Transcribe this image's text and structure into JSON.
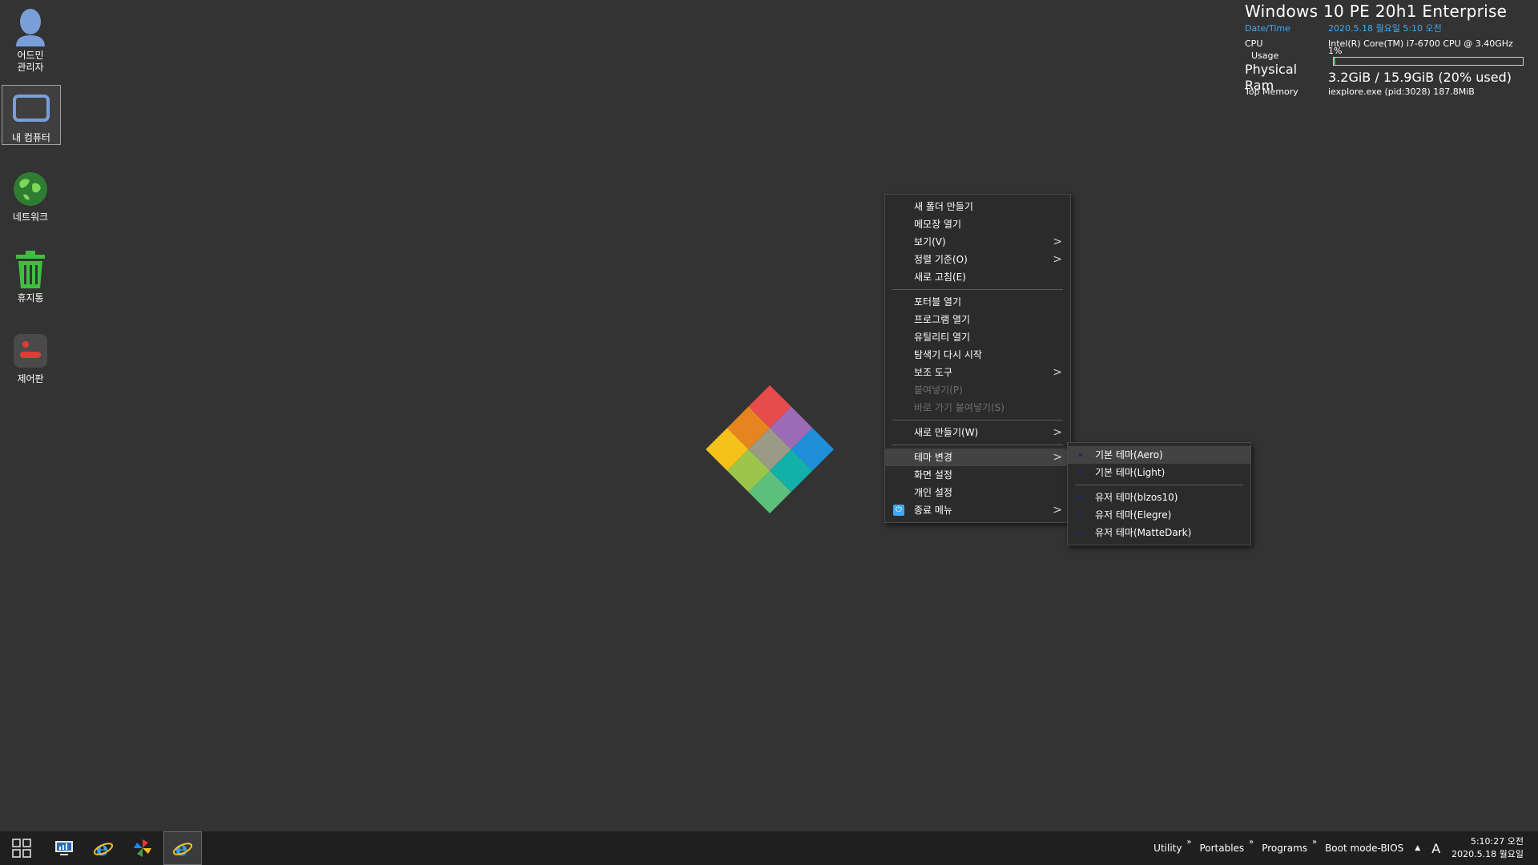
{
  "desktop_icons": [
    {
      "label": "어드민\n관리자",
      "icon": "user-icon"
    },
    {
      "label": "내 컴퓨터",
      "icon": "computer-icon"
    },
    {
      "label": "네트워크",
      "icon": "network-globe-icon"
    },
    {
      "label": "휴지통",
      "icon": "recycle-bin-icon"
    },
    {
      "label": "제어판",
      "icon": "control-panel-icon"
    }
  ],
  "sysinfo": {
    "title": "Windows 10 PE  20h1 Enterprise",
    "datetime_label": "Date/Time",
    "datetime_value": "2020.5.18 월요일 5:10 오전",
    "cpu_label": "CPU",
    "cpu_value": "Intel(R) Core(TM) i7-6700 CPU @ 3.40GHz",
    "usage_label": "Usage",
    "usage_value": "1%",
    "usage_fraction": 0.01,
    "ram_label": "Physical Ram",
    "ram_value": "3.2GiB / 15.9GiB (20% used)",
    "topmem_label": "Top Memory",
    "topmem_value": "iexplore.exe (pid:3028) 187.8MiB"
  },
  "context_menu": {
    "items": [
      {
        "label": "새 폴더 만들기"
      },
      {
        "label": "메모장 열기"
      },
      {
        "label": "보기(V)",
        "submenu": true
      },
      {
        "label": "정렬 기준(O)",
        "submenu": true
      },
      {
        "label": "새로 고침(E)"
      },
      {
        "label": "포터블 열기"
      },
      {
        "label": "프로그램 열기"
      },
      {
        "label": "유틸리티 열기"
      },
      {
        "label": "탐색기 다시 시작"
      },
      {
        "label": "보조 도구",
        "submenu": true
      },
      {
        "label": "붙여넣기(P)",
        "disabled": true
      },
      {
        "label": "바로 가기 붙여넣기(S)",
        "disabled": true
      },
      {
        "label": "새로 만들기(W)",
        "submenu": true
      },
      {
        "label": "테마 변경",
        "submenu": true,
        "highlighted": true
      },
      {
        "label": "화면 설정"
      },
      {
        "label": "개인 설정"
      },
      {
        "label": "종료 메뉴",
        "submenu": true,
        "icon": "power-icon"
      }
    ]
  },
  "theme_submenu": {
    "items": [
      {
        "label": "기본 테마(Aero)",
        "highlighted": true
      },
      {
        "label": "기본 테마(Light)"
      },
      {
        "label": "유저 테마(blzos10)"
      },
      {
        "label": "유저 테마(Elegre)"
      },
      {
        "label": "유저 테마(MatteDark)"
      }
    ]
  },
  "taskbar": {
    "buttons": [
      "start-grid-icon",
      "monitor-icon",
      "internet-explorer-icon",
      "pinwheel-icon",
      "internet-explorer-active-icon"
    ],
    "tray_items": [
      "Utility",
      "Portables",
      "Programs",
      "Boot mode-BIOS"
    ],
    "ime": "A",
    "clock_time": "5:10:27 오전",
    "clock_date": "2020.5.18 월요일"
  },
  "colors": {
    "desktop_bg": "#333333",
    "accent": "#3fa9f5",
    "taskbar_bg": "#1f1f1f"
  }
}
